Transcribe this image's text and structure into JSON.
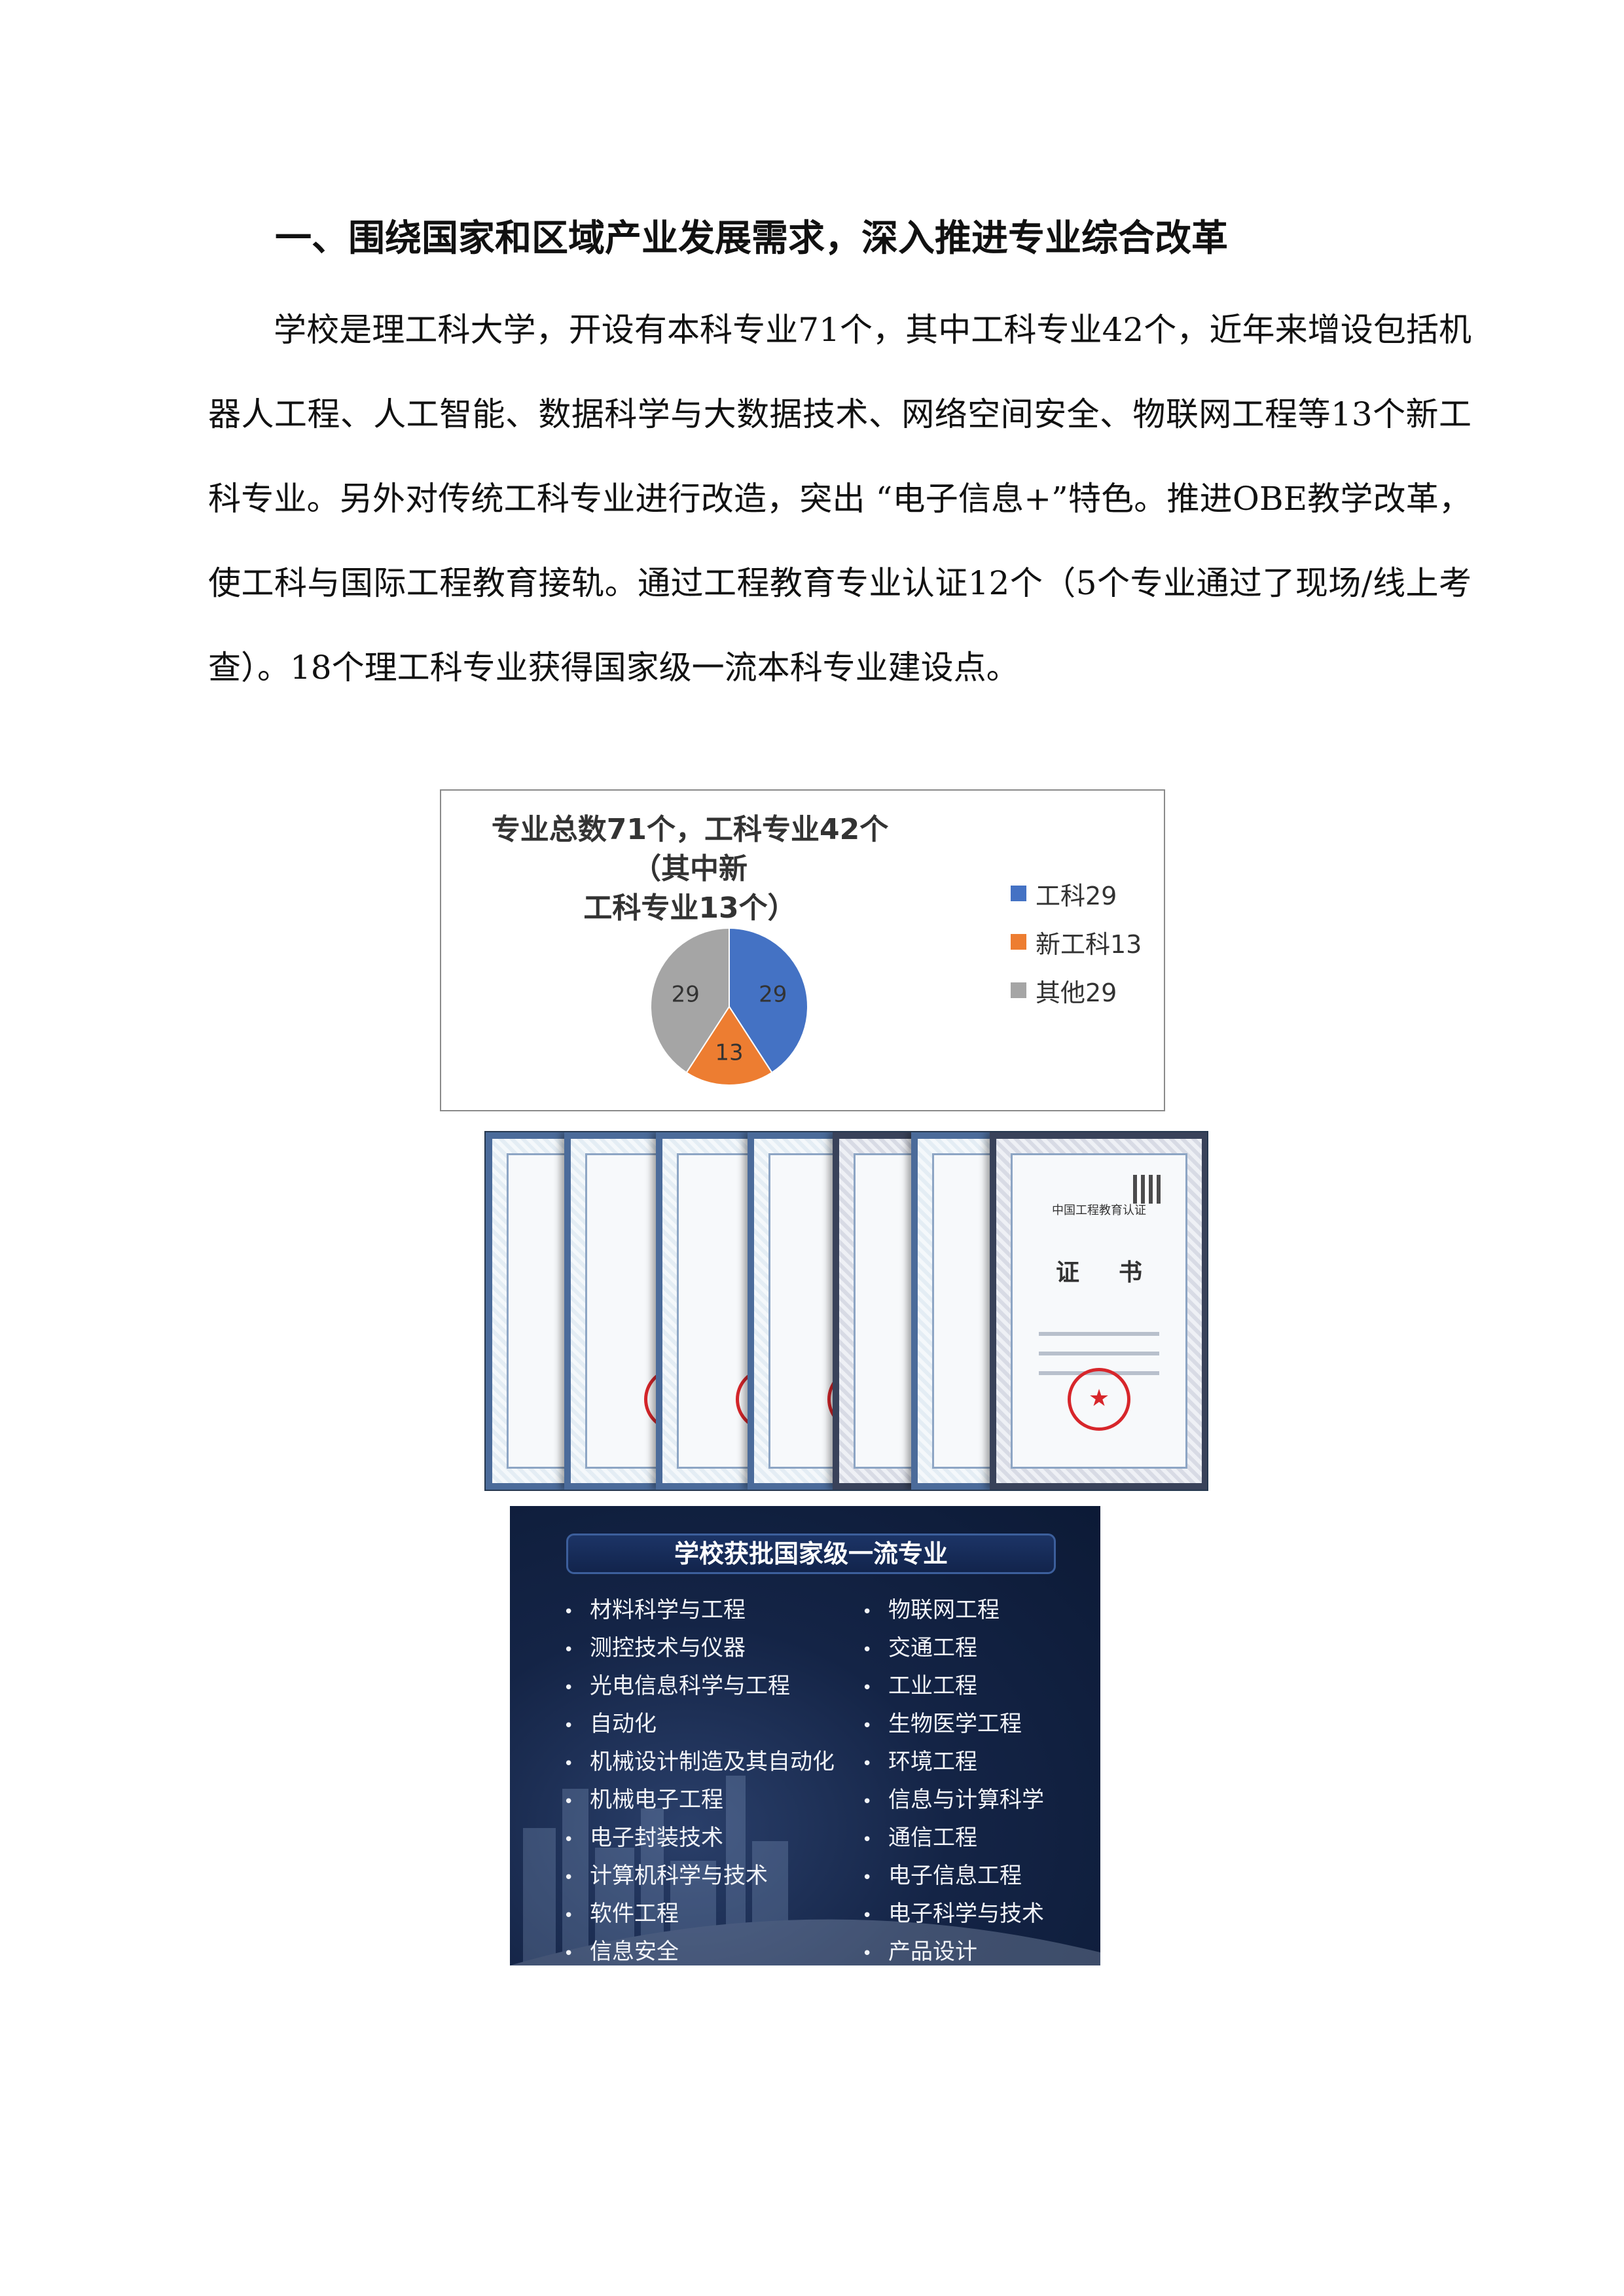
{
  "heading": "一、围绕国家和区域产业发展需求，深入推进专业综合改革",
  "paragraph": "学校是理工科大学，开设有本科专业71个，其中工科专业42个，近年来增设包括机器人工程、人工智能、数据科学与大数据技术、网络空间安全、物联网工程等13个新工科专业。另外对传统工科专业进行改造，突出 “电子信息+”特色。推进OBE教学改革，使工科与国际工程教育接轨。通过工程教育专业认证12个（5个专业通过了现场/线上考查）。18个理工科专业获得国家级一流本科专业建设点。",
  "chart_data": {
    "type": "pie",
    "title_line1": "专业总数71个，工科专业42个（其中新",
    "title_line2": "工科专业13个）",
    "categories": [
      "工科29",
      "新工科13",
      "其他29"
    ],
    "values": [
      29,
      13,
      29
    ],
    "value_labels": [
      "29",
      "13",
      "29"
    ],
    "colors": [
      "#4472c4",
      "#ed7d31",
      "#a5a5a5"
    ],
    "legend_position": "right"
  },
  "certificates": {
    "org_title": "中国工程教育认证",
    "doc_title": "证书",
    "seal_icon": "★"
  },
  "majors": {
    "title": "学校获批国家级一流专业",
    "left": [
      "材料科学与工程",
      "测控技术与仪器",
      "光电信息科学与工程",
      "自动化",
      "机械设计制造及其自动化",
      "机械电子工程",
      "电子封装技术",
      "计算机科学与技术",
      "软件工程",
      "信息安全"
    ],
    "right": [
      "物联网工程",
      "交通工程",
      "工业工程",
      "生物医学工程",
      "环境工程",
      "信息与计算科学",
      "通信工程",
      "电子信息工程",
      "电子科学与技术",
      "产品设计"
    ]
  }
}
